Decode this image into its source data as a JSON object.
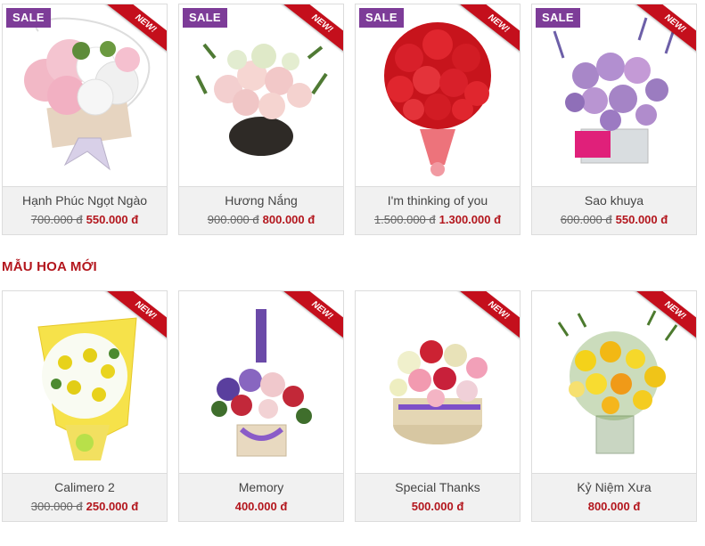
{
  "colors": {
    "accent": "#b3161d",
    "sale_badge": "#7d3c98",
    "ribbon": "#c40f1c"
  },
  "badges": {
    "sale": "SALE",
    "new": "NEW!"
  },
  "sale_products": [
    {
      "name": "Hạnh Phúc Ngọt Ngào",
      "old_price": "700.000 đ",
      "price": "550.000 đ"
    },
    {
      "name": "Hương Nắng",
      "old_price": "900.000 đ",
      "price": "800.000 đ"
    },
    {
      "name": "I'm thinking of you",
      "old_price": "1.500.000 đ",
      "price": "1.300.000 đ"
    },
    {
      "name": "Sao khuya",
      "old_price": "600.000 đ",
      "price": "550.000 đ"
    }
  ],
  "new_section": {
    "title": "MẪU HOA MỚI",
    "products": [
      {
        "name": "Calimero 2",
        "old_price": "300.000 đ",
        "price": "250.000 đ"
      },
      {
        "name": "Memory",
        "price": "400.000 đ"
      },
      {
        "name": "Special Thanks",
        "price": "500.000 đ"
      },
      {
        "name": "Kỷ Niệm Xưa",
        "price": "800.000 đ"
      }
    ]
  }
}
